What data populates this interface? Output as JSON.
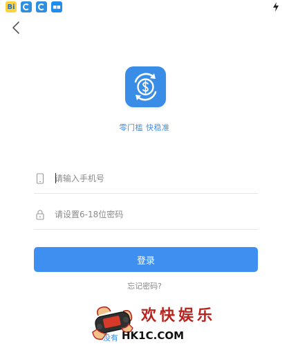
{
  "status_bar": {
    "icons": [
      "bilibili-icon",
      "app-icon",
      "app-icon",
      "app-icon",
      "charging-icon"
    ],
    "bili_label": "Bi"
  },
  "login": {
    "slogan": "零门槛 快稳准",
    "phone_placeholder": "请输入手机号",
    "password_placeholder": "请设置6-18位密码",
    "login_label": "登录",
    "forgot_label": "忘记密码?",
    "register_prefix": "没有"
  },
  "watermark": {
    "title": "欢快娱乐",
    "domain": "HK1C.COM"
  },
  "colors": {
    "accent": "#3f8ff0",
    "logo_bg": "#3a8de7",
    "watermark_red": "#b8231e"
  }
}
